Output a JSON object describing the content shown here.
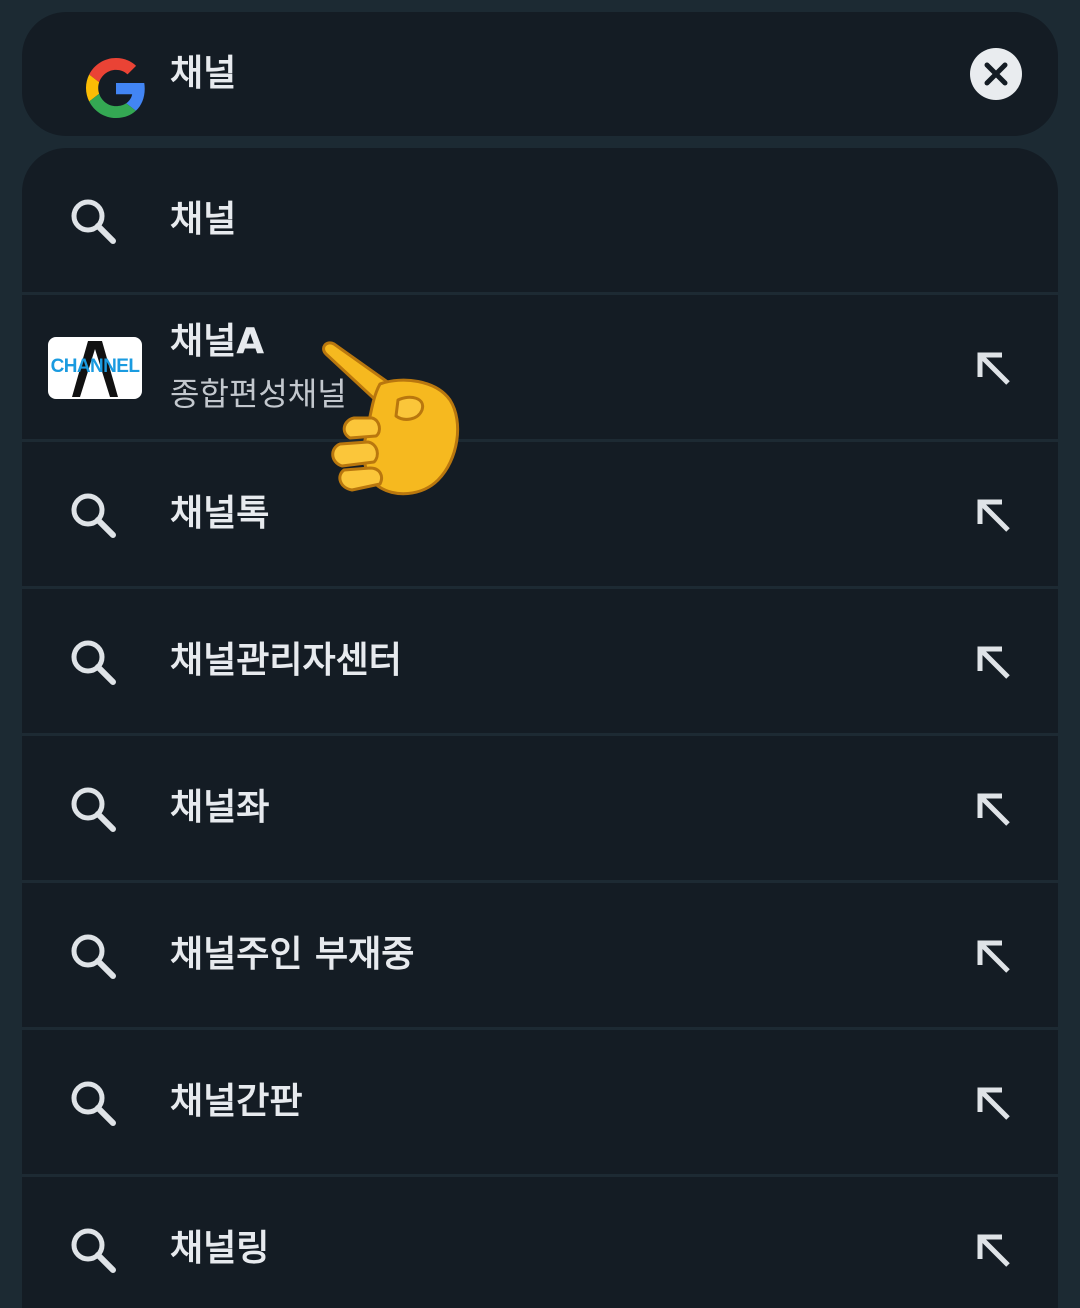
{
  "search": {
    "query": "채널",
    "engine_logo": "google-g-logo",
    "clear_icon": "close-icon"
  },
  "suggestions": [
    {
      "type": "query",
      "label": "채널",
      "icon": "search-icon",
      "fill_icon": false
    },
    {
      "type": "entity",
      "title": "채널A",
      "subtitle": "종합편성채널",
      "thumbnail_text": "CHANNEL",
      "icon": "fill-arrow-icon",
      "fill_icon": true
    },
    {
      "type": "query",
      "label": "채널톡",
      "icon": "search-icon",
      "fill_icon": true
    },
    {
      "type": "query",
      "label": "채널관리자센터",
      "icon": "search-icon",
      "fill_icon": true
    },
    {
      "type": "query",
      "label": "채널좌",
      "icon": "search-icon",
      "fill_icon": true
    },
    {
      "type": "query",
      "label": "채널주인 부재중",
      "icon": "search-icon",
      "fill_icon": true
    },
    {
      "type": "query",
      "label": "채널간판",
      "icon": "search-icon",
      "fill_icon": true
    },
    {
      "type": "query",
      "label": "채널링",
      "icon": "search-icon",
      "fill_icon": true
    }
  ],
  "overlay": {
    "icon": "pointing-hand-emoji"
  },
  "colors": {
    "background": "#1c2a33",
    "surface": "#141c24",
    "text": "#e7eaee",
    "subtext": "#c3c8ce",
    "google_blue": "#4285F4",
    "google_red": "#EA4335",
    "google_yellow": "#FBBC05",
    "google_green": "#34A853"
  }
}
